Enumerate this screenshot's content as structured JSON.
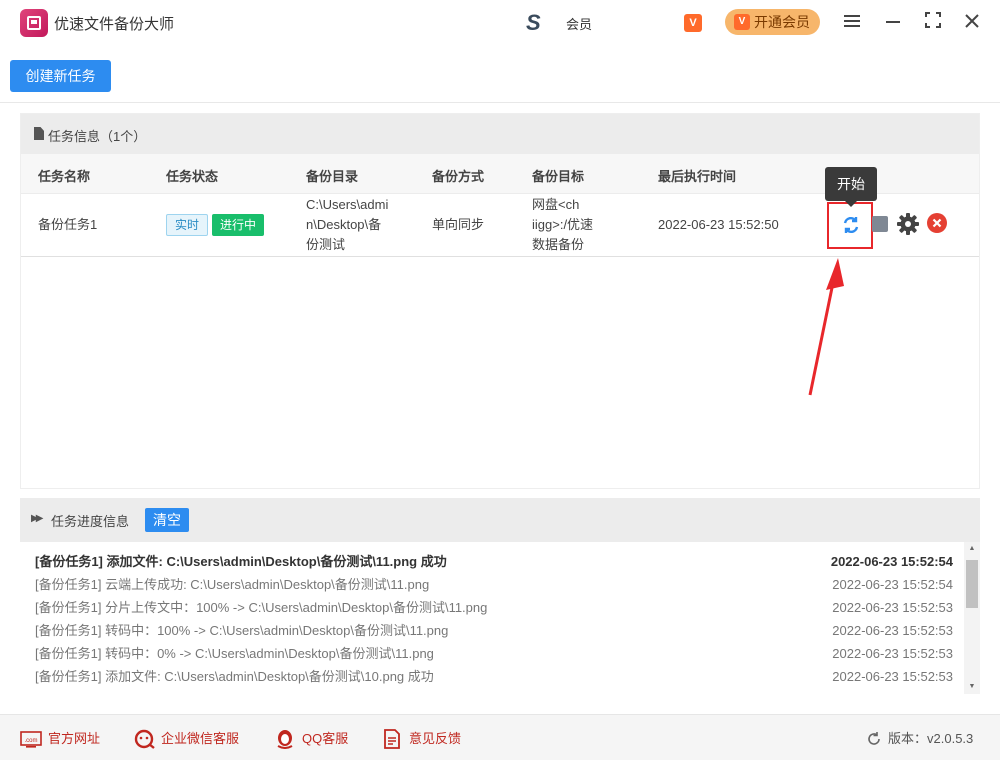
{
  "window": {
    "title": "优速文件备份大师",
    "user_name": "会员",
    "vip_small_icon": "V",
    "vip_button_label": "开通会员",
    "controls": [
      "menu",
      "minimize",
      "maximize",
      "close"
    ]
  },
  "toolbar": {
    "create_task_label": "创建新任务"
  },
  "task_panel": {
    "title": "任务信息（1个）",
    "columns": [
      "任务名称",
      "任务状态",
      "备份目录",
      "备份方式",
      "备份目标",
      "最后执行时间"
    ],
    "rows": [
      {
        "name": "备份任务1",
        "badge_realtime": "实时",
        "badge_status": "进行中",
        "dir_line1": "C:\\Users\\admi",
        "dir_line2": "n\\Desktop\\备",
        "dir_line3": "份测试",
        "method": "单向同步",
        "target_line1": "网盘<ch",
        "target_line2": "iigg>:/优速",
        "target_line3": "数据备份",
        "last_run": "2022-06-23 15:52:50"
      }
    ],
    "tooltip": "开始",
    "colors": {
      "start_highlight": "#e8272b",
      "arrow": "#e8272b",
      "running_badge": "#19be6b"
    }
  },
  "progress_panel": {
    "title": "任务进度信息",
    "clear_label": "清空",
    "logs": [
      {
        "msg": "[备份任务1] 添加文件:   C:\\Users\\admin\\Desktop\\备份测试\\11.png 成功",
        "time": "2022-06-23 15:52:54"
      },
      {
        "msg": "[备份任务1] 云端上传成功: C:\\Users\\admin\\Desktop\\备份测试\\11.png",
        "time": "2022-06-23 15:52:54"
      },
      {
        "msg": "[备份任务1] 分片上传文中：100% -> C:\\Users\\admin\\Desktop\\备份测试\\11.png",
        "time": "2022-06-23 15:52:53"
      },
      {
        "msg": "[备份任务1] 转码中：100% -> C:\\Users\\admin\\Desktop\\备份测试\\11.png",
        "time": "2022-06-23 15:52:53"
      },
      {
        "msg": "[备份任务1] 转码中：0% -> C:\\Users\\admin\\Desktop\\备份测试\\11.png",
        "time": "2022-06-23 15:52:53"
      },
      {
        "msg": "[备份任务1] 添加文件:   C:\\Users\\admin\\Desktop\\备份测试\\10.png 成功",
        "time": "2022-06-23 15:52:53"
      }
    ]
  },
  "footer": {
    "official_site": "官方网址",
    "wechat_service": "企业微信客服",
    "qq_service": "QQ客服",
    "feedback": "意见反馈",
    "version_label": "版本：",
    "version": "v2.0.5.3"
  }
}
